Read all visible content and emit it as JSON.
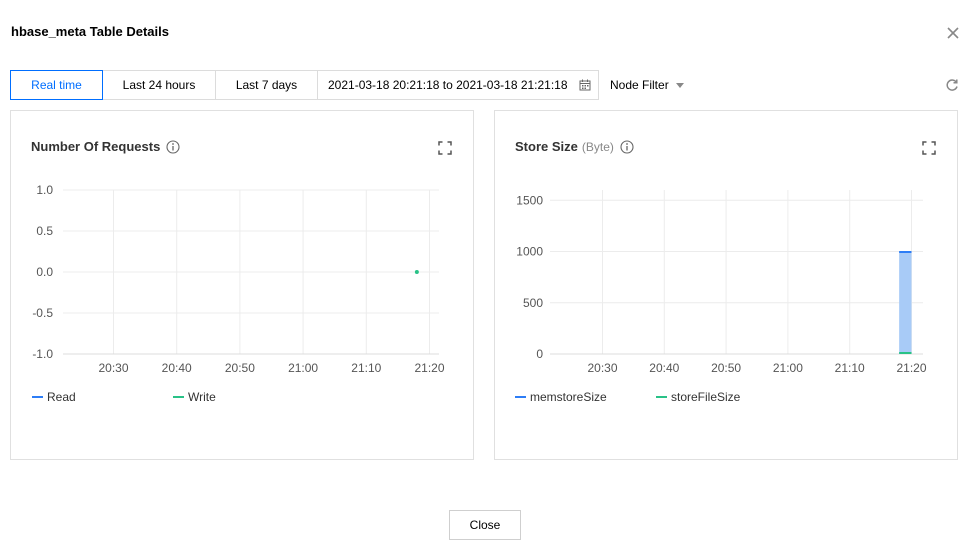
{
  "dialog": {
    "title": "hbase_meta Table Details",
    "close_button_label": "Close"
  },
  "toolbar": {
    "tabs": [
      {
        "label": "Real time",
        "active": true
      },
      {
        "label": "Last 24 hours",
        "active": false
      },
      {
        "label": "Last 7 days",
        "active": false
      }
    ],
    "date_range": "2021-03-18 20:21:18 to 2021-03-18 21:21:18",
    "node_filter_label": "Node Filter"
  },
  "colors": {
    "accent": "#006eff",
    "series_blue": "#2d7df6",
    "series_green": "#29c287",
    "bar_fill": "#a8cbf7"
  },
  "icons": [
    "close-icon",
    "calendar-icon",
    "chevron-down-icon",
    "refresh-icon",
    "info-icon",
    "expand-icon"
  ],
  "chart_data": [
    {
      "type": "line",
      "title": "Number Of Requests",
      "x": [
        "20:30",
        "20:40",
        "20:50",
        "21:00",
        "21:10",
        "21:20"
      ],
      "ylim": [
        -1.0,
        1.0
      ],
      "yticks": [
        "1.0",
        "0.5",
        "0.0",
        "-0.5",
        "-1.0"
      ],
      "grid": true,
      "legend_position": "bottom-left",
      "series": [
        {
          "name": "Read",
          "points": []
        },
        {
          "name": "Write",
          "points": [
            {
              "x": "21:18",
              "y": 0
            }
          ]
        }
      ]
    },
    {
      "type": "area",
      "title": "Store Size",
      "unit": "(Byte)",
      "x": [
        "20:30",
        "20:40",
        "20:50",
        "21:00",
        "21:10",
        "21:20"
      ],
      "ylim": [
        0,
        1600
      ],
      "yticks": [
        "1500",
        "1000",
        "500",
        "0"
      ],
      "grid": true,
      "legend_position": "bottom-left",
      "series": [
        {
          "name": "memstoreSize",
          "points": [
            {
              "x": "21:18",
              "y": 1000
            },
            {
              "x": "21:20",
              "y": 1000
            }
          ]
        },
        {
          "name": "storeFileSize",
          "points": [
            {
              "x": "21:18",
              "y": 0
            },
            {
              "x": "21:20",
              "y": 0
            }
          ]
        }
      ]
    }
  ]
}
